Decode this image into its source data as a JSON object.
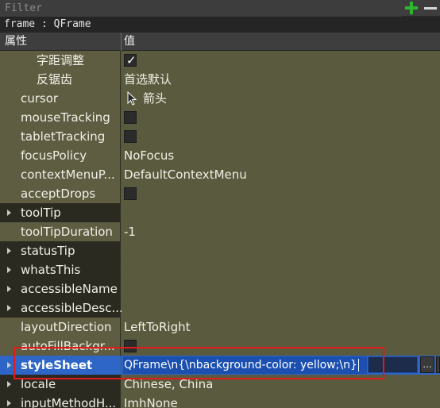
{
  "filter": {
    "placeholder": "Filter"
  },
  "object_bar": {
    "text": "frame : QFrame"
  },
  "header": {
    "property": "属性",
    "value": "值"
  },
  "rows": [
    {
      "label": "字距调整",
      "value": ""
    },
    {
      "label": "反锯齿",
      "value": "首选默认"
    },
    {
      "label": "cursor",
      "value": "箭头",
      "icon": "arrow-cursor-icon"
    },
    {
      "label": "mouseTracking",
      "value": ""
    },
    {
      "label": "tabletTracking",
      "value": ""
    },
    {
      "label": "focusPolicy",
      "value": "NoFocus"
    },
    {
      "label": "contextMenuP...",
      "value": "DefaultContextMenu"
    },
    {
      "label": "acceptDrops",
      "value": ""
    },
    {
      "label": "toolTip",
      "value": ""
    },
    {
      "label": "toolTipDuration",
      "value": "-1"
    },
    {
      "label": "statusTip",
      "value": ""
    },
    {
      "label": "whatsThis",
      "value": ""
    },
    {
      "label": "accessibleName",
      "value": ""
    },
    {
      "label": "accessibleDesc...",
      "value": ""
    },
    {
      "label": "layoutDirection",
      "value": "LeftToRight"
    },
    {
      "label": "autoFillBackgr...",
      "value": ""
    },
    {
      "label": "styleSheet",
      "value": "QFrame\\n{\\nbackground-color: yellow;\\n}"
    },
    {
      "label": "locale",
      "value": "Chinese, China"
    },
    {
      "label": "inputMethodH...",
      "value": "ImhNone"
    }
  ],
  "stylesheet": {
    "edit_button": "..."
  },
  "checks": {
    "kerning": true,
    "mouseTracking": false,
    "tabletTracking": false,
    "acceptDrops": false,
    "autoFillBackground": false
  },
  "colors": {
    "highlight_border": "#e21a1a",
    "selection": "#2e66c8",
    "add_icon": "#2fb52f"
  }
}
